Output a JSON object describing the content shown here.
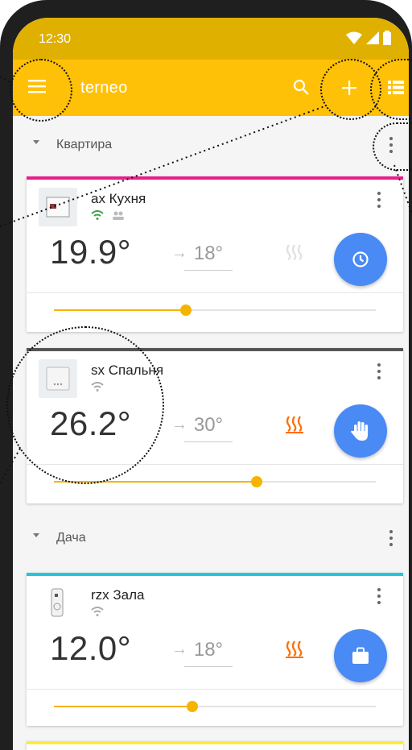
{
  "status_bar": {
    "time": "12:30"
  },
  "app_bar": {
    "title": "terneo"
  },
  "groups": [
    {
      "label": "Квартира"
    },
    {
      "label": "Дача"
    }
  ],
  "devices": [
    {
      "name": "ax Кухня",
      "temperature": "19.9°",
      "setpoint": "18°",
      "mode_icon": "clock-icon",
      "heating_active": false,
      "slider_level": 0.41,
      "top_color": "#e91e8c"
    },
    {
      "name": "sx Спальня",
      "temperature": "26.2°",
      "setpoint": "30°",
      "mode_icon": "hand-icon",
      "heating_active": true,
      "slider_level": 0.63,
      "top_color": "#555555"
    },
    {
      "name": "rzx Зала",
      "temperature": "12.0°",
      "setpoint": "18°",
      "mode_icon": "briefcase-icon",
      "heating_active": true,
      "slider_level": 0.43,
      "top_color": "#26c6da"
    }
  ],
  "colors": {
    "app_bar": "#ffc107",
    "status_bar": "#e0b000",
    "fab": "#4a8af4",
    "slider": "#f4b400",
    "heat_active": "#ff6d00",
    "heat_inactive": "#e0e0e0"
  }
}
